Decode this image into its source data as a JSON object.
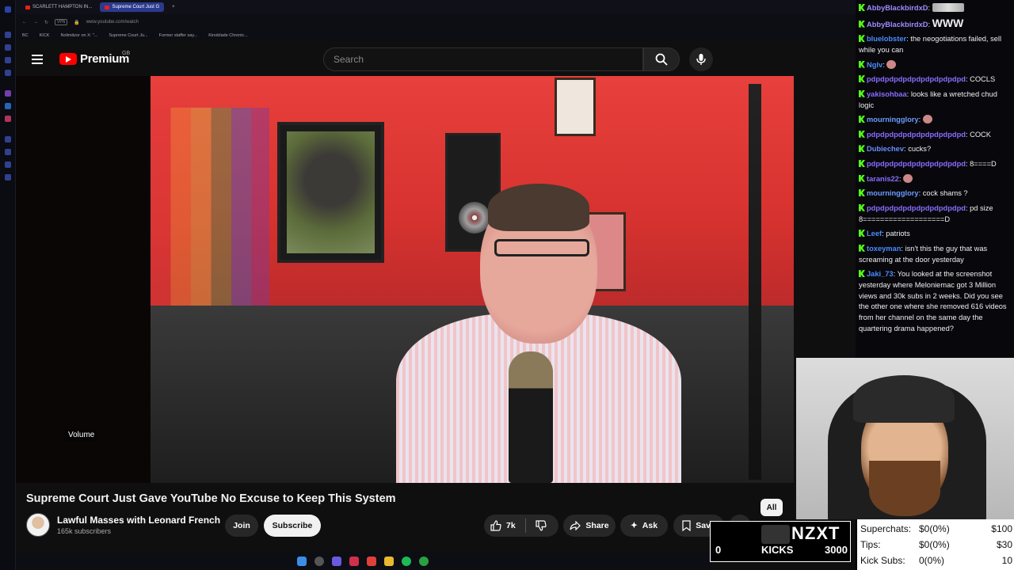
{
  "browser": {
    "tabs": [
      {
        "label": "SCARLETT HAMPTON IN..."
      },
      {
        "label": "Supreme Court Just G"
      }
    ],
    "address": "www.youtube.com/watch",
    "vpn": "VPN",
    "bookmarks": [
      "BC",
      "KICK",
      "Nolimitzor on X: \"...",
      "Supreme Court Ju...",
      "Former staffer say...",
      "Kinoblade Chronic..."
    ]
  },
  "youtube": {
    "logo_text": "Premium",
    "region": "GB",
    "search_placeholder": "Search",
    "video": {
      "volume_label": "Volume",
      "title": "Supreme Court Just Gave YouTube No Excuse to Keep This System"
    },
    "channel": {
      "name": "Lawful Masses with Leonard French",
      "subscribers": "165k subscribers"
    },
    "buttons": {
      "join": "Join",
      "subscribe": "Subscribe",
      "likes": "7k",
      "share": "Share",
      "ask": "Ask",
      "save": "Save"
    },
    "chip_all": "All"
  },
  "chat": {
    "messages": [
      {
        "user": "AbbyBlackbirdxD",
        "color": "#9c8cff",
        "text": "",
        "emote": "big"
      },
      {
        "user": "AbbyBlackbirdxD",
        "color": "#9c8cff",
        "text": "WWW",
        "emote": ""
      },
      {
        "user": "bluelobster",
        "color": "#4a8cff",
        "text": "the neogotiations failed, sell while you can",
        "emote": ""
      },
      {
        "user": "Nglv",
        "color": "#4a8cff",
        "text": "",
        "emote": "small"
      },
      {
        "user": "pdpdpdpdpdpdpdpdpdpdpd",
        "color": "#8a6cff",
        "text": "COCLS",
        "emote": ""
      },
      {
        "user": "yakisohbaa",
        "color": "#8a6cff",
        "text": "looks like a wretched chud logic",
        "emote": ""
      },
      {
        "user": "mourningglory",
        "color": "#6a9cff",
        "text": "",
        "emote": "small"
      },
      {
        "user": "pdpdpdpdpdpdpdpdpdpdpd",
        "color": "#8a6cff",
        "text": "COCK",
        "emote": ""
      },
      {
        "user": "Dubiechev",
        "color": "#6a8cff",
        "text": "cucks?",
        "emote": ""
      },
      {
        "user": "pdpdpdpdpdpdpdpdpdpdpd",
        "color": "#8a6cff",
        "text": "8====D",
        "emote": ""
      },
      {
        "user": "taranis22",
        "color": "#8a6cff",
        "text": "",
        "emote": "small"
      },
      {
        "user": "mourningglory",
        "color": "#6a9cff",
        "text": "cock shams ?",
        "emote": ""
      },
      {
        "user": "pdpdpdpdpdpdpdpdpdpdpd",
        "color": "#8a6cff",
        "text": "pd size 8===================D",
        "emote": ""
      },
      {
        "user": "Leef",
        "color": "#4a8cff",
        "text": "patriots",
        "emote": ""
      },
      {
        "user": "toxeyman",
        "color": "#4a8cff",
        "text": "isn't this the guy that was screaming at the door yesterday",
        "emote": ""
      },
      {
        "user": "Jaki_73",
        "color": "#4a8cff",
        "text": "You looked at the screenshot yesterday where Meloniemac got 3 Million views and 30k subs in 2 weeks. Did you see the other one where she removed 616 videos from her channel on the same day the quartering drama happened?",
        "emote": ""
      }
    ]
  },
  "kicks_widget": {
    "count": "0",
    "label": "KICKS",
    "brand": "NZXT",
    "goal": "3000"
  },
  "stats": {
    "superchats": {
      "label": "Superchats:",
      "value": "$0(0%)",
      "goal": "$100"
    },
    "tips": {
      "label": "Tips:",
      "value": "$0(0%)",
      "goal": "$30"
    },
    "kick_subs": {
      "label": "Kick Subs:",
      "value": "0(0%)",
      "goal": "10"
    }
  },
  "colors": {
    "accent": "#ff0000",
    "kick_green": "#53fc18",
    "background": "#0f0f0f"
  }
}
